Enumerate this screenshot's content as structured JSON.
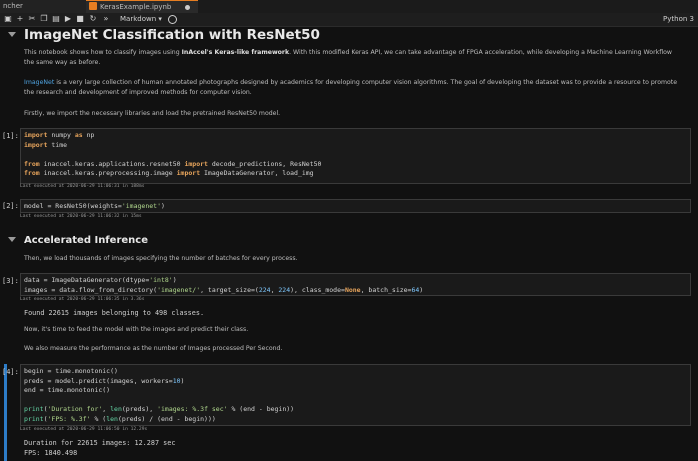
{
  "tabs": [
    {
      "label": "ncher"
    },
    {
      "label": "KerasExample.ipynb"
    }
  ],
  "toolbar": {
    "cell_type": "Markdown",
    "kernel": "Python 3"
  },
  "cells": {
    "title": "ImageNet Classification with ResNet50",
    "intro_p1_a": "This notebook shows how to classify images using ",
    "intro_p1_b": "InAccel's Keras-like framework",
    "intro_p1_c": ". With this modified Keras API, we can take advantage of FPGA acceleration, while developing a Machine Learning Workflow the same way as before.",
    "intro_p2_link": "ImageNet",
    "intro_p2_rest": " is a very large collection of human annotated photographs designed by academics for developing computer vision algorithms. The goal of developing the dataset was to provide a resource to promote the research and development of improved methods for computer vision.",
    "intro_p3": "Firstly, we import the necessary libraries and load the pretrained ResNet50 model.",
    "c1_prompt": "[1]:",
    "c1_exec": "Last executed at 2020-06-29 11:06:31 in 188ms",
    "c2_prompt": "[2]:",
    "c2_exec": "Last executed at 2020-06-29 11:06:32 in 15ms",
    "section2": "Accelerated Inference",
    "s2_p1": "Then, we load thousands of images specifying the number of batches for every process.",
    "c3_prompt": "[3]:",
    "c3_exec": "Last executed at 2020-06-29 11:06:35 in 3.36s",
    "c3_output": "Found 22615 images belonging to 498 classes.",
    "s2_p2": "Now, it's time to feed the model with the images and predict their class.",
    "s2_p3": "We also measure the performance as the number of Images processed Per Second.",
    "c4_prompt": "[4]:",
    "c4_exec": "Last executed at 2020-06-29 11:06:50 in 12.29s",
    "c4_output_1": "Duration for 22615 images: 12.287 sec",
    "c4_output_2": "FPS: 1840.498"
  },
  "colors": {
    "background": "#111111",
    "accent": "#e67e22",
    "link": "#4fa3e0",
    "active_cell": "#2d7cc7"
  },
  "icons": [
    "save-icon",
    "add-icon",
    "cut-icon",
    "copy-icon",
    "paste-icon",
    "run-icon",
    "stop-icon",
    "restart-icon",
    "fast-forward-icon",
    "kernel-status-icon"
  ]
}
